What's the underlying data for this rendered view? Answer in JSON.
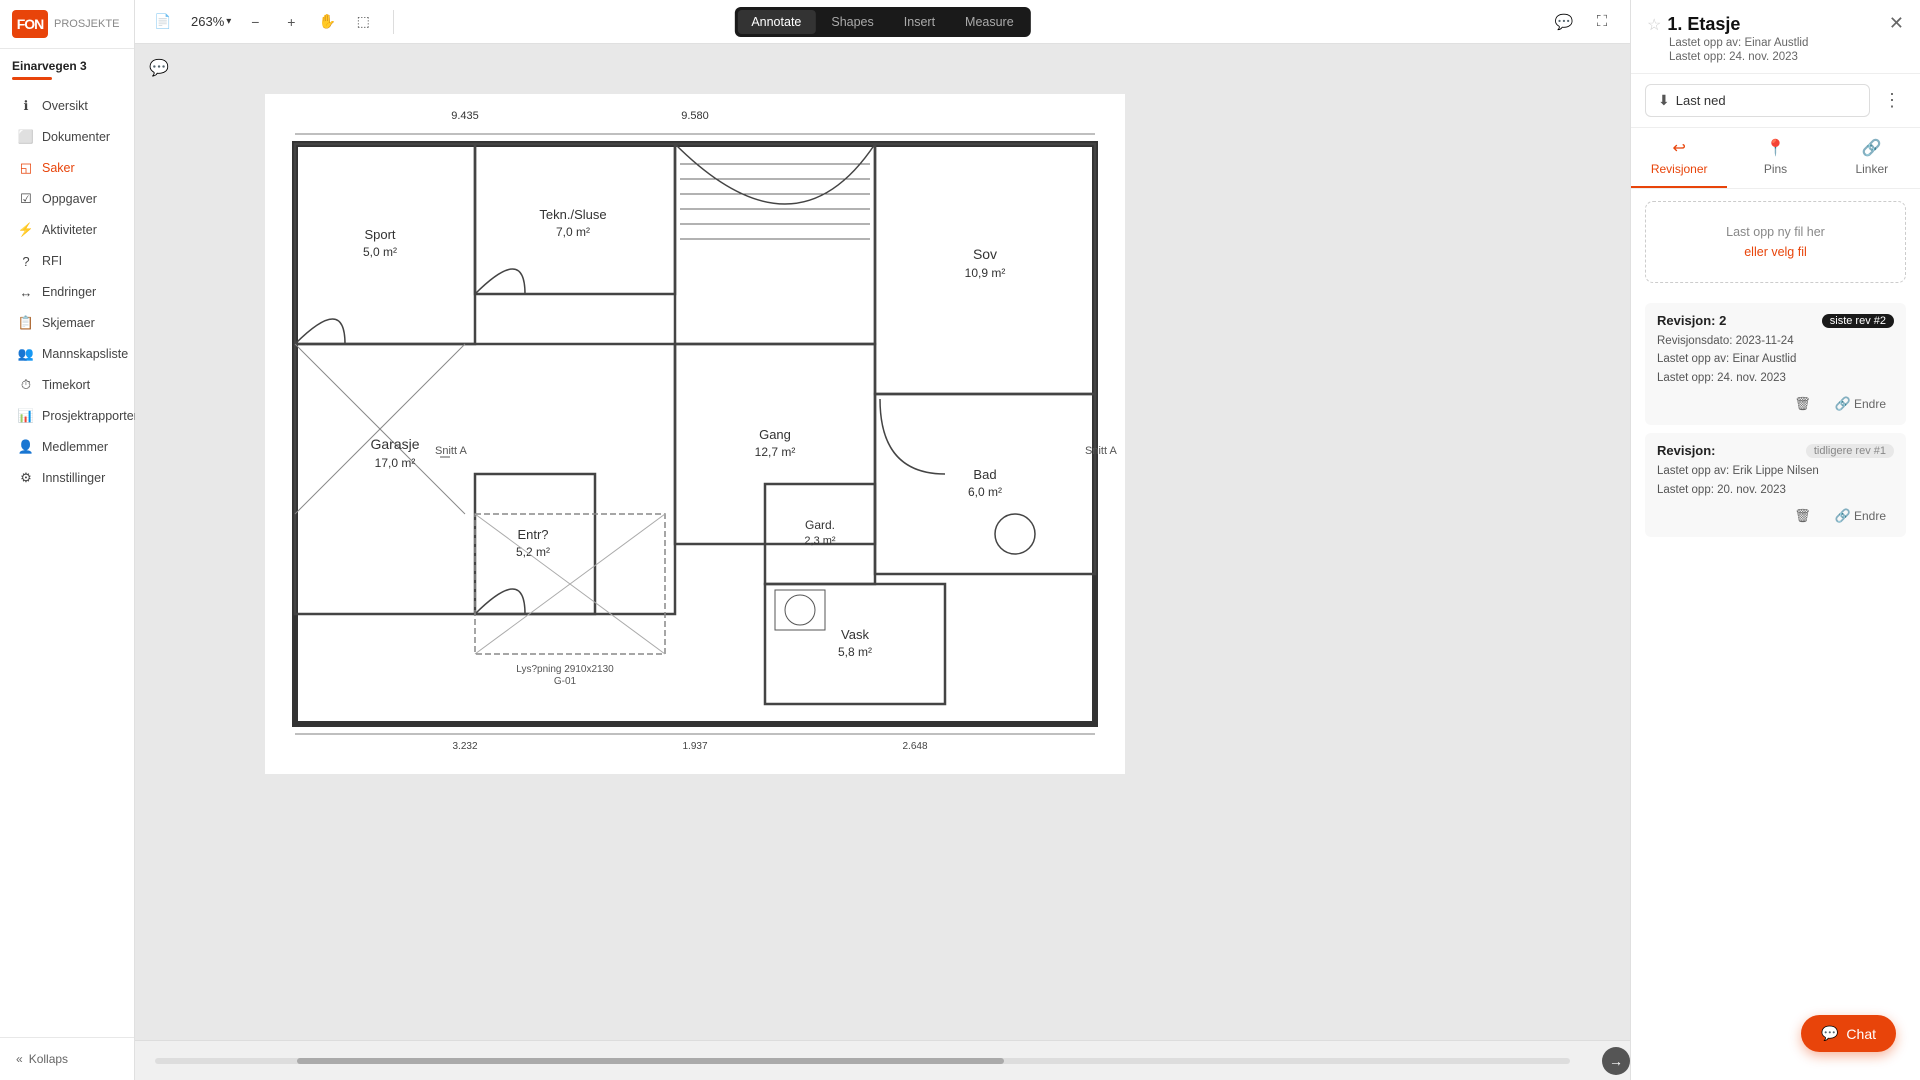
{
  "app": {
    "logo_text": "FON",
    "project_label": "PROSJEKTE",
    "project_name": "Einarvegen 3",
    "project_sub_color": "#e8440a"
  },
  "sidebar": {
    "items": [
      {
        "id": "oversikt",
        "label": "Oversikt",
        "icon": "ℹ"
      },
      {
        "id": "dokumenter",
        "label": "Dokumenter",
        "icon": "⬜"
      },
      {
        "id": "saker",
        "label": "Saker",
        "icon": "◱"
      },
      {
        "id": "oppgaver",
        "label": "Oppgaver",
        "icon": "☑"
      },
      {
        "id": "aktiviteter",
        "label": "Aktiviteter",
        "icon": "⚡"
      },
      {
        "id": "rfi",
        "label": "RFI",
        "icon": "?"
      },
      {
        "id": "endringer",
        "label": "Endringer",
        "icon": "↔"
      },
      {
        "id": "skjemaer",
        "label": "Skjemaer",
        "icon": "📋"
      },
      {
        "id": "mannskapsliste",
        "label": "Mannskapsliste",
        "icon": "👥"
      },
      {
        "id": "timekort",
        "label": "Timekort",
        "icon": "⏱"
      },
      {
        "id": "prosjektrapporter",
        "label": "Prosjektrapporter",
        "icon": "📊"
      },
      {
        "id": "medlemmer",
        "label": "Medlemmer",
        "icon": "👤"
      },
      {
        "id": "innstillinger",
        "label": "Innstillinger",
        "icon": "⚙"
      }
    ],
    "collapse_label": "Kollaps"
  },
  "toolbar": {
    "zoom": "263%",
    "tabs": [
      {
        "id": "annotate",
        "label": "Annotate",
        "active": true
      },
      {
        "id": "shapes",
        "label": "Shapes",
        "active": false
      },
      {
        "id": "insert",
        "label": "Insert",
        "active": false
      },
      {
        "id": "measure",
        "label": "Measure",
        "active": false
      }
    ]
  },
  "right_panel": {
    "title": "1. Etasje",
    "uploaded_by_label": "Lastet opp av:",
    "uploaded_by": "Einar Austlid",
    "uploaded_date_label": "Lastet opp:",
    "uploaded_date": "24. nov. 2023",
    "download_label": "Last ned",
    "more_label": "...",
    "tabs": [
      {
        "id": "revisjoner",
        "label": "Revisjoner",
        "icon": "↩",
        "active": true
      },
      {
        "id": "pins",
        "label": "Pins",
        "icon": "📍",
        "active": false
      },
      {
        "id": "linker",
        "label": "Linker",
        "icon": "🔗",
        "active": false
      }
    ],
    "upload_text": "Last opp ny fil her",
    "upload_or": "eller velg fil",
    "revisions": [
      {
        "title": "Revisjon: 2",
        "badge": "siste rev #2",
        "badge_type": "latest",
        "date_label": "Revisjonsdato:",
        "date": "2023-11-24",
        "author_label": "Lastet opp av:",
        "author": "Einar Austlid",
        "upload_date_label": "Lastet opp:",
        "upload_date": "24. nov. 2023",
        "actions": [
          "delete",
          "edit"
        ]
      },
      {
        "title": "Revisjon:",
        "badge": "tidligere rev #1",
        "badge_type": "old",
        "date_label": "",
        "date": "",
        "author_label": "Lastet opp av:",
        "author": "Erik Lippe Nilsen",
        "upload_date_label": "Lastet opp:",
        "upload_date": "20. nov. 2023",
        "actions": [
          "delete",
          "edit"
        ]
      }
    ],
    "edit_label": "Endre",
    "delete_label": "Slett"
  },
  "chat": {
    "label": "Chat"
  },
  "nav": {
    "next_label": "→"
  }
}
